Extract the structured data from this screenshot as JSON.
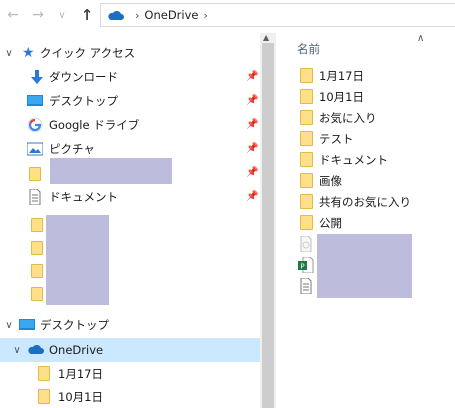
{
  "address": {
    "location": "OneDrive"
  },
  "nav": {
    "quick_access": "クイック アクセス",
    "pinned": [
      {
        "label": "ダウンロード",
        "icon": "download-arrow-icon"
      },
      {
        "label": "デスクトップ",
        "icon": "desktop-icon"
      },
      {
        "label": "Google ドライブ",
        "icon": "google-drive-icon"
      },
      {
        "label": "ピクチャ",
        "icon": "pictures-icon"
      },
      {
        "label": "",
        "icon": "folder-icon"
      },
      {
        "label": "ドキュメント",
        "icon": "documents-icon"
      }
    ],
    "desktop": "デスクトップ",
    "onedrive": "OneDrive",
    "onedrive_children": [
      "1月17日",
      "10月1日"
    ]
  },
  "content": {
    "column_name": "名前",
    "folders": [
      "1月17日",
      "10月1日",
      "お気に入り",
      "テスト",
      "ドキュメント",
      "画像",
      "共有のお気に入り",
      "公開"
    ]
  },
  "colors": {
    "accent": "#1a6fc0",
    "selection": "#cce8ff",
    "folder": "#ffe08a",
    "redacted": "#bebcdc"
  }
}
